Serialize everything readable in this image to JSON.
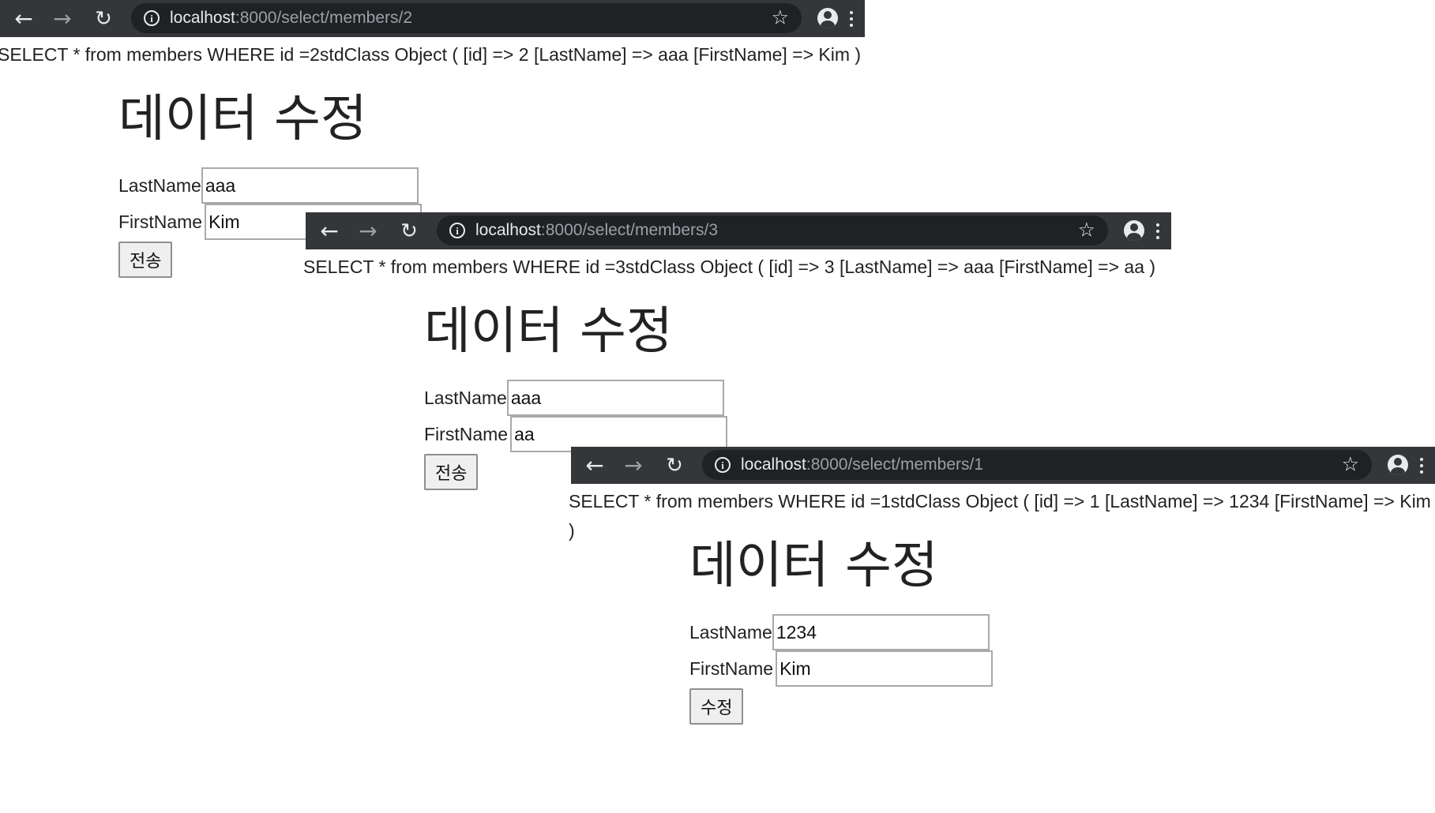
{
  "windows": [
    {
      "url_host": "localhost",
      "url_path": ":8000/select/members/2",
      "query_text": "SELECT * from members WHERE id =2stdClass Object ( [id] => 2 [LastName] => aaa [FirstName] => Kim )",
      "heading": "데이터 수정",
      "last_name_label": "LastName",
      "last_name_value": "aaa",
      "first_name_label": "FirstName",
      "first_name_value": "Kim",
      "submit_label": "전송"
    },
    {
      "url_host": "localhost",
      "url_path": ":8000/select/members/3",
      "query_text": "SELECT * from members WHERE id =3stdClass Object ( [id] => 3 [LastName] => aaa [FirstName] => aa )",
      "heading": "데이터 수정",
      "last_name_label": "LastName",
      "last_name_value": "aaa",
      "first_name_label": "FirstName",
      "first_name_value": "aa",
      "submit_label": "전송"
    },
    {
      "url_host": "localhost",
      "url_path": ":8000/select/members/1",
      "query_text": "SELECT * from members WHERE id =1stdClass Object ( [id] => 1 [LastName] => 1234 [FirstName] => Kim )",
      "heading": "데이터 수정",
      "last_name_label": "LastName",
      "last_name_value": "1234",
      "first_name_label": "FirstName",
      "first_name_value": "Kim",
      "submit_label": "수정"
    }
  ],
  "icons": {
    "back": "back-arrow-icon",
    "forward": "forward-arrow-icon",
    "reload": "reload-icon",
    "info": "info-icon",
    "star": "star-icon",
    "profile": "profile-icon",
    "menu": "menu-icon"
  },
  "colors": {
    "toolbar": "#35363a",
    "omnibox": "#202124",
    "toolbar_text": "#e8eaed",
    "url_path": "#9aa0a6"
  }
}
